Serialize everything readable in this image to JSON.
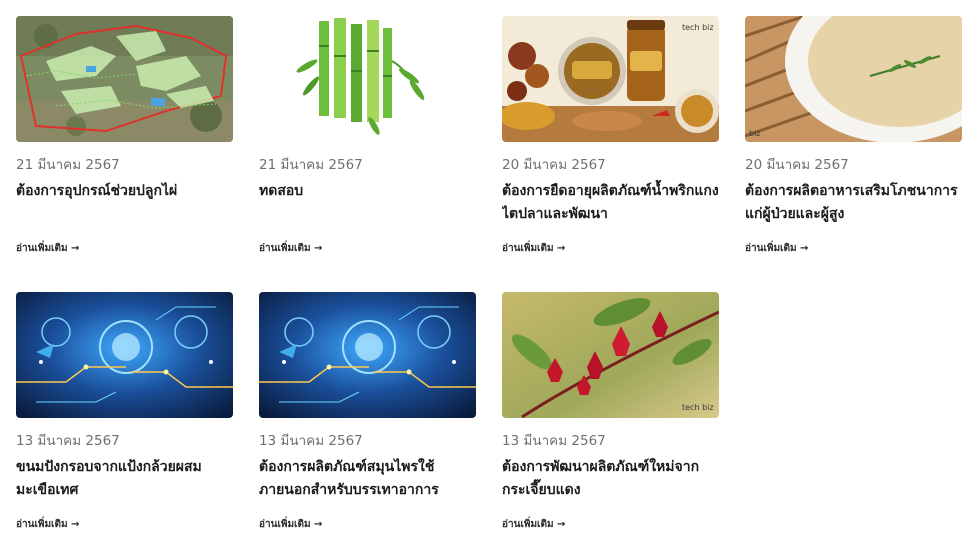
{
  "posts": [
    {
      "date": "21 มีนาคม 2567",
      "title": "ต้องการอุปกรณ์ช่วยปลูกไผ่",
      "read_more": "อ่านเพิ่มเติม →",
      "image": "farm-aerial-map"
    },
    {
      "date": "21 มีนาคม 2567",
      "title": "ทดสอบ",
      "read_more": "อ่านเพิ่มเติม →",
      "image": "bamboo"
    },
    {
      "date": "20 มีนาคม 2567",
      "title": "ต้องการยืดอายุผลิตภัณฑ์น้ำพริกแกงไตปลาและพัฒนา",
      "read_more": "อ่านเพิ่มเติม →",
      "image": "chili-paste-jars"
    },
    {
      "date": "20 มีนาคม 2567",
      "title": "ต้องการผลิตอาหารเสริมโภชนาการแก่ผู้ป่วยและผู้สูง",
      "read_more": "อ่านเพิ่มเติม →",
      "image": "soup-bowl"
    },
    {
      "date": "13 มีนาคม 2567",
      "title": "ขนมปังกรอบจากแป้งกล้วยผสมมะเขือเทศ",
      "read_more": "อ่านเพิ่มเติม →",
      "image": "tech-circuit"
    },
    {
      "date": "13 มีนาคม 2567",
      "title": "ต้องการผลิตภัณฑ์สมุนไพรใช้ภายนอกสำหรับบรรเทาอาการ",
      "read_more": "อ่านเพิ่มเติม →",
      "image": "tech-circuit"
    },
    {
      "date": "13 มีนาคม 2567",
      "title": "ต้องการพัฒนาผลิตภัณฑ์ใหม่จากกระเจี๊ยบแดง",
      "read_more": "อ่านเพิ่มเติม →",
      "image": "roselle-flowers"
    }
  ],
  "watermark": "tech biz"
}
